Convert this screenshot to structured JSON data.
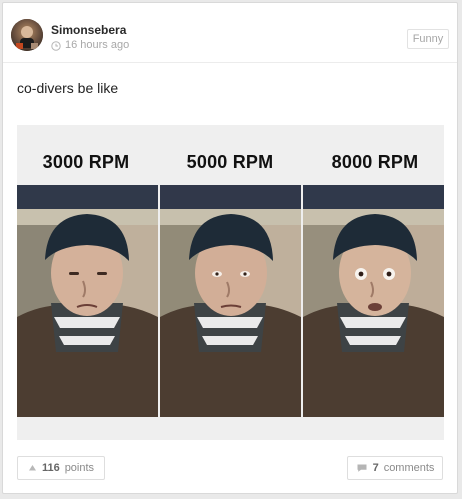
{
  "post": {
    "author": "Simonsebera",
    "time": "16 hours ago",
    "tag": "Funny",
    "caption": "co-divers be like"
  },
  "meme": {
    "labels": [
      "3000 RPM",
      "5000 RPM",
      "8000 RPM"
    ]
  },
  "footer": {
    "points_count": "116",
    "points_label": "points",
    "comments_count": "7",
    "comments_label": "comments"
  },
  "icons": {
    "clock": "clock-icon",
    "upvote": "upvote-arrow-icon",
    "comment": "comment-bubble-icon"
  },
  "colors": {
    "page_background": "#e9e9e9",
    "card_background": "#ffffff",
    "text_primary": "#222222",
    "muted": "#a8a8a8"
  }
}
